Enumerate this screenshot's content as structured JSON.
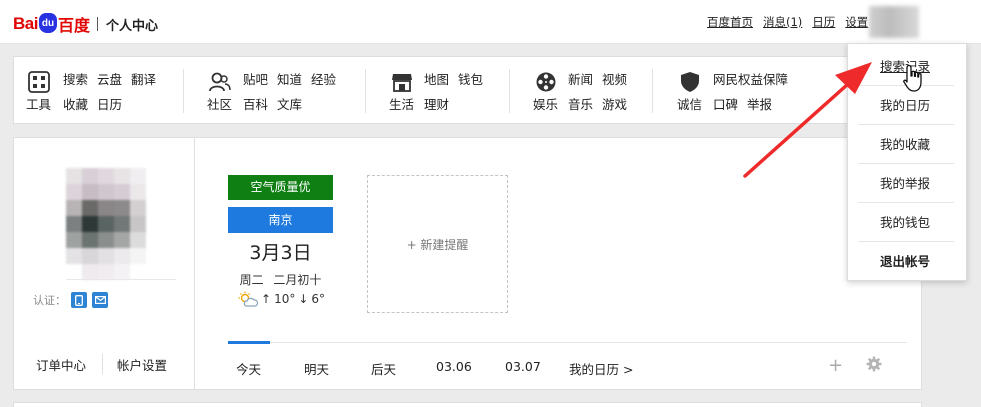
{
  "header": {
    "logo_bai": "Bai",
    "logo_paw": "du",
    "logo_cn": "百度",
    "subtitle": "个人中心",
    "nav": [
      "百度首页",
      "消息(1)",
      "日历",
      "设置"
    ]
  },
  "services": {
    "tools": {
      "category": "工具",
      "icon": "grid-icon",
      "row1": [
        "搜索",
        "云盘",
        "翻译"
      ],
      "row2": [
        "收藏",
        "日历"
      ]
    },
    "community": {
      "category": "社区",
      "icon": "people-icon",
      "row1": [
        "贴吧",
        "知道",
        "经验"
      ],
      "row2": [
        "百科",
        "文库"
      ]
    },
    "life": {
      "category": "生活",
      "icon": "store-icon",
      "row1": [
        "地图",
        "钱包"
      ],
      "row2": [
        "理财"
      ]
    },
    "entertainment": {
      "category": "娱乐",
      "icon": "film-reel-icon",
      "row1": [
        "新闻",
        "视频"
      ],
      "row2": [
        "音乐",
        "游戏"
      ]
    },
    "trust": {
      "category": "诚信",
      "icon": "shield-icon",
      "row1": [
        "网民权益保障"
      ],
      "row2": [
        "口碑",
        "举报"
      ]
    }
  },
  "profile": {
    "auth_label": "认证：",
    "links": [
      "订单中心",
      "帐户设置"
    ]
  },
  "calendar": {
    "aqi": "空气质量优",
    "aqi_color": "#0f7f14",
    "city": "南京",
    "city_color": "#1f7ae0",
    "date": "3月3日",
    "weekday": "周二",
    "lunar": "二月初十",
    "temp_high": "10°",
    "temp_low": "6°",
    "new_reminder": "+ 新建提醒",
    "tabs": [
      "今天",
      "明天",
      "后天",
      "03.06",
      "03.07",
      "我的日历 >"
    ]
  },
  "dropdown": {
    "items": [
      "搜索记录",
      "我的日历",
      "我的收藏",
      "我的举报",
      "我的钱包",
      "退出帐号"
    ]
  },
  "annotation": {
    "arrow_color": "#ee2a2a"
  }
}
